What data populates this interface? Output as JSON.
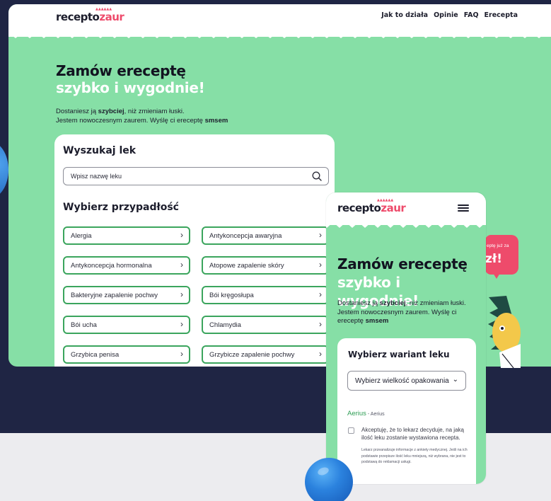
{
  "brand": {
    "logo_dark": "recepto",
    "logo_accent": "zaur",
    "crown": "▲▲▲▲▲▲"
  },
  "nav": [
    "Jak to działa",
    "Opinie",
    "FAQ",
    "Erecepta"
  ],
  "hero": {
    "title_line1": "Zamów ereceptę",
    "title_line2": "szybko i wygodnie!",
    "desc_a": "Dostaniesz ją ",
    "desc_bold1": "szybciej",
    "desc_b": ", niż zmieniam łuski.",
    "desc_c": "Jestem nowoczesnym zaurem. Wyślę ci ereceptę ",
    "desc_bold2": "smsem"
  },
  "search": {
    "heading": "Wyszukaj lek",
    "placeholder": "Wpisz nazwę leku",
    "icon": "search-icon"
  },
  "conditions": {
    "heading": "Wybierz przypadłość",
    "items": [
      "Alergia",
      "Antykoncepcja awaryjna",
      "Antykoncepcja hormonalna",
      "Atopowe zapalenie skóry",
      "Bakteryjne zapalenie pochwy",
      "Bói kręgosłupa",
      "Bói ucha",
      "Chlamydia",
      "Grzybica penisa",
      "Grzybicze zapalenie pochwy"
    ],
    "chevron": "›"
  },
  "mobile": {
    "title_line1": "Zamów ereceptę",
    "title_line2": "szybko i wygodnie!",
    "desc_a": "Dostaniesz ją ",
    "desc_bold1": "szybciej",
    "desc_b": ", niż zmieniam łuski. Jestem nowoczesnym zaurem. Wyślę ci ereceptę ",
    "desc_bold2": "smsem",
    "variant": {
      "heading": "Wybierz wariant leku",
      "select_value": "Wybierz wielkość opakowania",
      "select_chevron": "⌄",
      "drug_name": "Aerius",
      "drug_sub": " - Aerius",
      "accept_text": "Akceptuję, że to lekarz decyduje, na jaką ilość leku zostanie wystawiona recepta.",
      "fine_print": "Lekarz przeanalizuje informacje z ankiety medycznej. Jeśli na ich podstawie przepisze ilość leku mniejszą, niż wybrana, nie jest to podstawą do reklamacji usługi."
    }
  },
  "promo": {
    "line1": "eptę już za",
    "line2": "zł!"
  },
  "colors": {
    "green": "#86dfa6",
    "accent": "#ee4b6b",
    "navy": "#1f2544",
    "border_green": "#3ba55d"
  }
}
